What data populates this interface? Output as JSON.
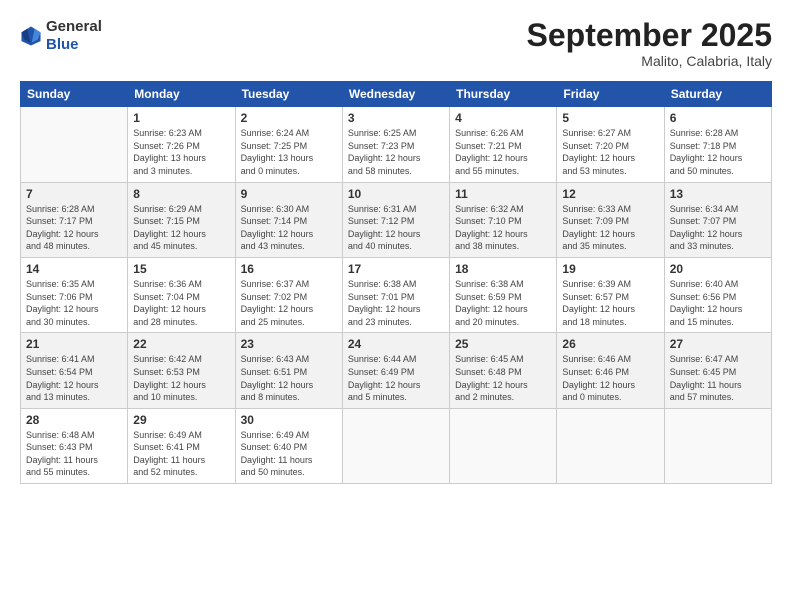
{
  "header": {
    "logo_general": "General",
    "logo_blue": "Blue",
    "month": "September 2025",
    "location": "Malito, Calabria, Italy"
  },
  "days_of_week": [
    "Sunday",
    "Monday",
    "Tuesday",
    "Wednesday",
    "Thursday",
    "Friday",
    "Saturday"
  ],
  "weeks": [
    [
      {
        "day": "",
        "detail": ""
      },
      {
        "day": "1",
        "detail": "Sunrise: 6:23 AM\nSunset: 7:26 PM\nDaylight: 13 hours\nand 3 minutes."
      },
      {
        "day": "2",
        "detail": "Sunrise: 6:24 AM\nSunset: 7:25 PM\nDaylight: 13 hours\nand 0 minutes."
      },
      {
        "day": "3",
        "detail": "Sunrise: 6:25 AM\nSunset: 7:23 PM\nDaylight: 12 hours\nand 58 minutes."
      },
      {
        "day": "4",
        "detail": "Sunrise: 6:26 AM\nSunset: 7:21 PM\nDaylight: 12 hours\nand 55 minutes."
      },
      {
        "day": "5",
        "detail": "Sunrise: 6:27 AM\nSunset: 7:20 PM\nDaylight: 12 hours\nand 53 minutes."
      },
      {
        "day": "6",
        "detail": "Sunrise: 6:28 AM\nSunset: 7:18 PM\nDaylight: 12 hours\nand 50 minutes."
      }
    ],
    [
      {
        "day": "7",
        "detail": "Sunrise: 6:28 AM\nSunset: 7:17 PM\nDaylight: 12 hours\nand 48 minutes."
      },
      {
        "day": "8",
        "detail": "Sunrise: 6:29 AM\nSunset: 7:15 PM\nDaylight: 12 hours\nand 45 minutes."
      },
      {
        "day": "9",
        "detail": "Sunrise: 6:30 AM\nSunset: 7:14 PM\nDaylight: 12 hours\nand 43 minutes."
      },
      {
        "day": "10",
        "detail": "Sunrise: 6:31 AM\nSunset: 7:12 PM\nDaylight: 12 hours\nand 40 minutes."
      },
      {
        "day": "11",
        "detail": "Sunrise: 6:32 AM\nSunset: 7:10 PM\nDaylight: 12 hours\nand 38 minutes."
      },
      {
        "day": "12",
        "detail": "Sunrise: 6:33 AM\nSunset: 7:09 PM\nDaylight: 12 hours\nand 35 minutes."
      },
      {
        "day": "13",
        "detail": "Sunrise: 6:34 AM\nSunset: 7:07 PM\nDaylight: 12 hours\nand 33 minutes."
      }
    ],
    [
      {
        "day": "14",
        "detail": "Sunrise: 6:35 AM\nSunset: 7:06 PM\nDaylight: 12 hours\nand 30 minutes."
      },
      {
        "day": "15",
        "detail": "Sunrise: 6:36 AM\nSunset: 7:04 PM\nDaylight: 12 hours\nand 28 minutes."
      },
      {
        "day": "16",
        "detail": "Sunrise: 6:37 AM\nSunset: 7:02 PM\nDaylight: 12 hours\nand 25 minutes."
      },
      {
        "day": "17",
        "detail": "Sunrise: 6:38 AM\nSunset: 7:01 PM\nDaylight: 12 hours\nand 23 minutes."
      },
      {
        "day": "18",
        "detail": "Sunrise: 6:38 AM\nSunset: 6:59 PM\nDaylight: 12 hours\nand 20 minutes."
      },
      {
        "day": "19",
        "detail": "Sunrise: 6:39 AM\nSunset: 6:57 PM\nDaylight: 12 hours\nand 18 minutes."
      },
      {
        "day": "20",
        "detail": "Sunrise: 6:40 AM\nSunset: 6:56 PM\nDaylight: 12 hours\nand 15 minutes."
      }
    ],
    [
      {
        "day": "21",
        "detail": "Sunrise: 6:41 AM\nSunset: 6:54 PM\nDaylight: 12 hours\nand 13 minutes."
      },
      {
        "day": "22",
        "detail": "Sunrise: 6:42 AM\nSunset: 6:53 PM\nDaylight: 12 hours\nand 10 minutes."
      },
      {
        "day": "23",
        "detail": "Sunrise: 6:43 AM\nSunset: 6:51 PM\nDaylight: 12 hours\nand 8 minutes."
      },
      {
        "day": "24",
        "detail": "Sunrise: 6:44 AM\nSunset: 6:49 PM\nDaylight: 12 hours\nand 5 minutes."
      },
      {
        "day": "25",
        "detail": "Sunrise: 6:45 AM\nSunset: 6:48 PM\nDaylight: 12 hours\nand 2 minutes."
      },
      {
        "day": "26",
        "detail": "Sunrise: 6:46 AM\nSunset: 6:46 PM\nDaylight: 12 hours\nand 0 minutes."
      },
      {
        "day": "27",
        "detail": "Sunrise: 6:47 AM\nSunset: 6:45 PM\nDaylight: 11 hours\nand 57 minutes."
      }
    ],
    [
      {
        "day": "28",
        "detail": "Sunrise: 6:48 AM\nSunset: 6:43 PM\nDaylight: 11 hours\nand 55 minutes."
      },
      {
        "day": "29",
        "detail": "Sunrise: 6:49 AM\nSunset: 6:41 PM\nDaylight: 11 hours\nand 52 minutes."
      },
      {
        "day": "30",
        "detail": "Sunrise: 6:49 AM\nSunset: 6:40 PM\nDaylight: 11 hours\nand 50 minutes."
      },
      {
        "day": "",
        "detail": ""
      },
      {
        "day": "",
        "detail": ""
      },
      {
        "day": "",
        "detail": ""
      },
      {
        "day": "",
        "detail": ""
      }
    ]
  ]
}
